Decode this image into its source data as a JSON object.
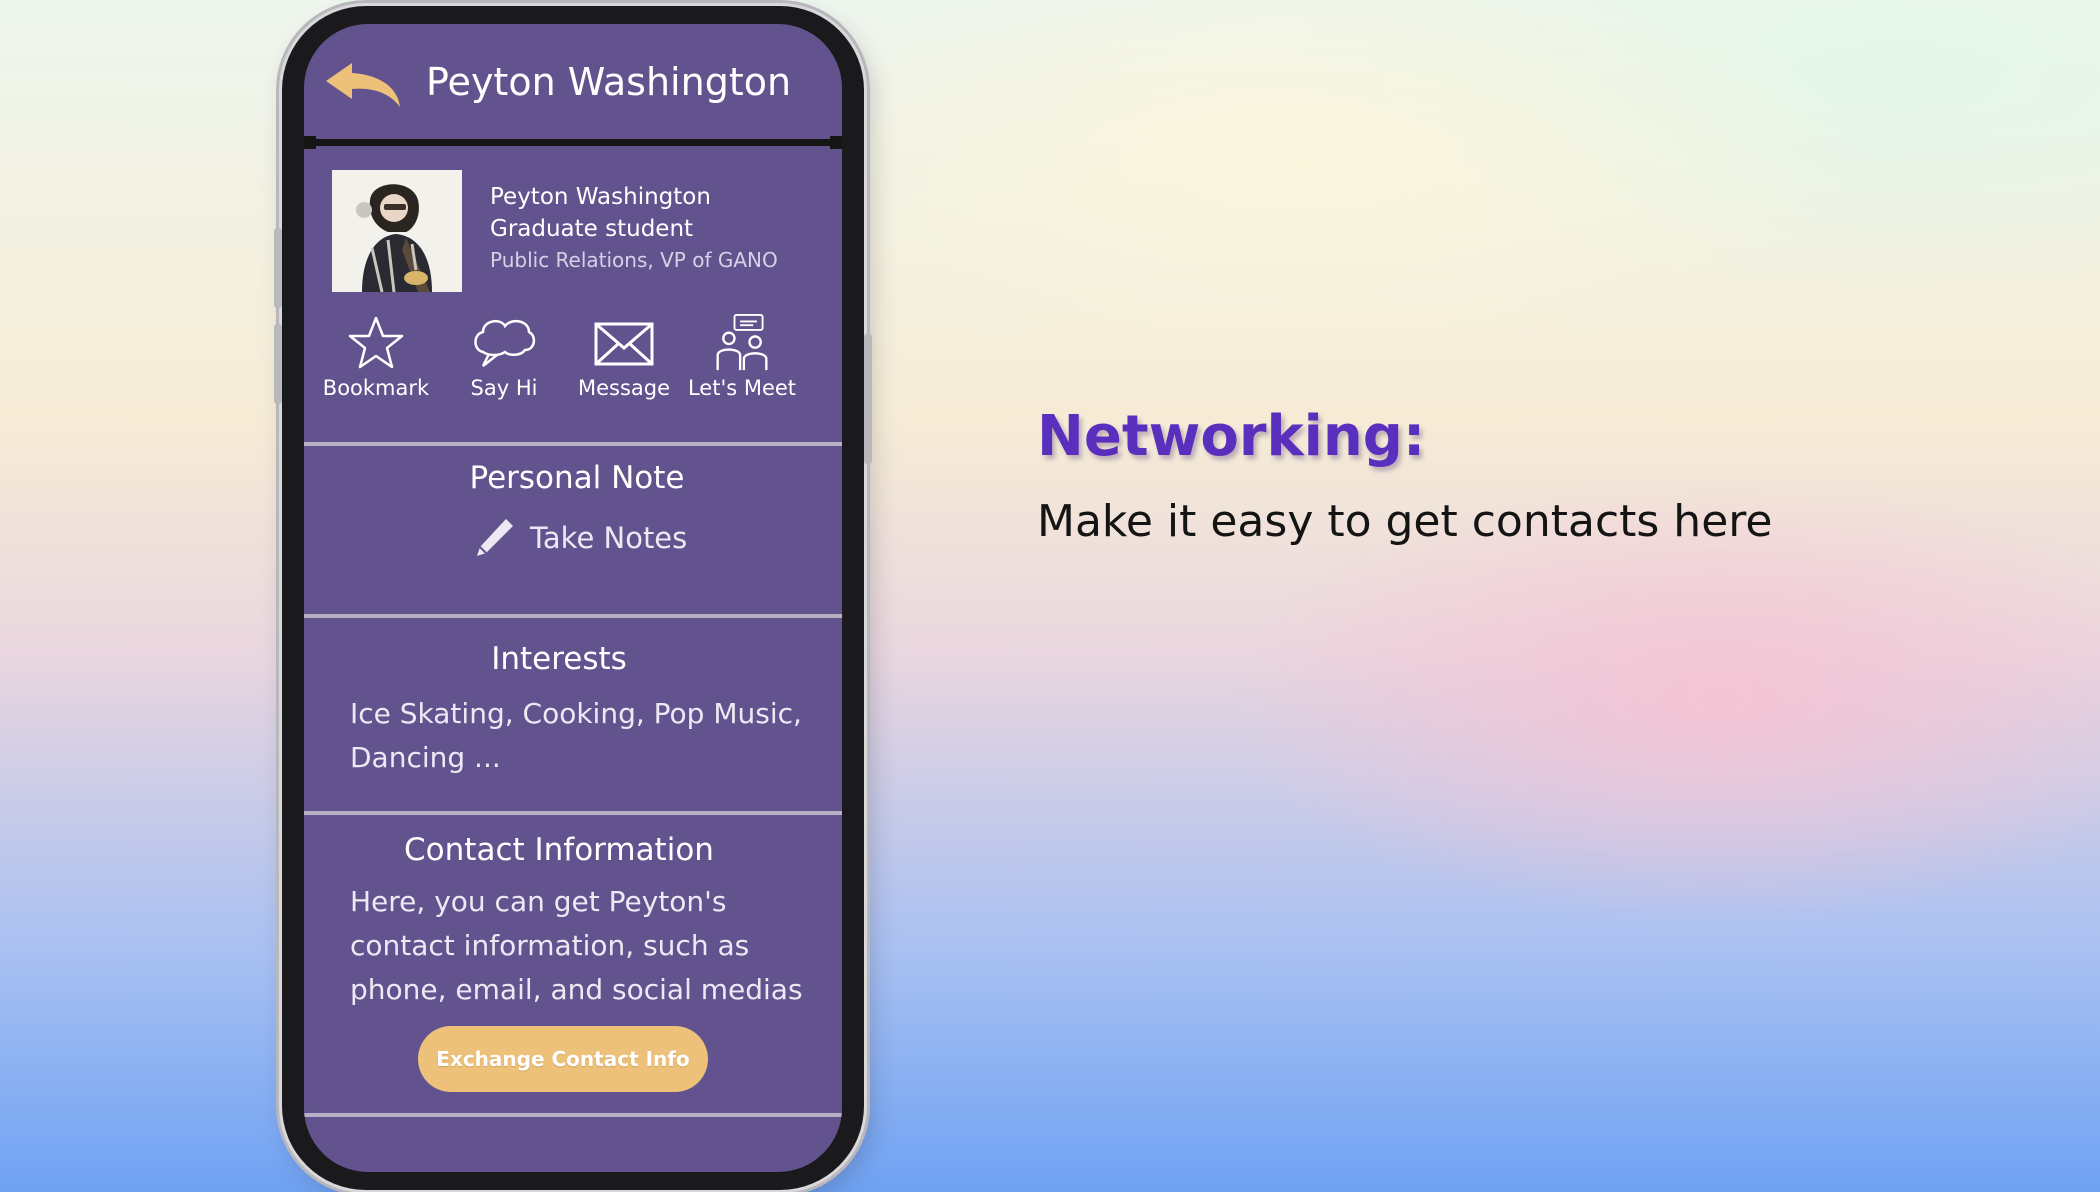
{
  "phone": {
    "title": "Peyton Washington",
    "profile": {
      "name": "Peyton Washington",
      "role": "Graduate student",
      "organization": "Public Relations, VP of GANO"
    },
    "actions": [
      {
        "label": "Bookmark",
        "icon": "star-icon"
      },
      {
        "label": "Say Hi",
        "icon": "speech-bubble-icon"
      },
      {
        "label": "Message",
        "icon": "envelope-icon"
      },
      {
        "label": "Let's Meet",
        "icon": "people-chat-icon"
      }
    ],
    "personal_note": {
      "title": "Personal Note",
      "action_label": "Take Notes"
    },
    "interests": {
      "title": "Interests",
      "text": "Ice Skating, Cooking, Pop Music, Dancing ..."
    },
    "contact": {
      "title": "Contact Information",
      "text": "Here, you can get Peyton's contact information, such as phone, email, and social medias",
      "button_label": "Exchange Contact Info"
    }
  },
  "slide": {
    "headline": "Networking:",
    "subline": "Make it easy to get contacts here"
  },
  "colors": {
    "screen_bg": "#62538f",
    "accent": "#eec17a",
    "headline": "#5b2fbe"
  }
}
